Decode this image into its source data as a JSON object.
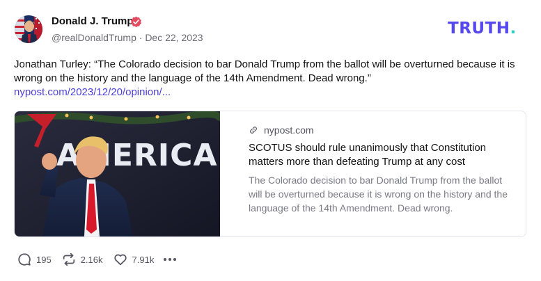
{
  "author": {
    "display_name": "Donald J. Trump",
    "handle": "@realDonaldTrump",
    "date": "Dec 22, 2023",
    "verified": true
  },
  "brand": {
    "name": "TRUTH",
    "dot": "."
  },
  "post": {
    "text": "Jonathan Turley: “The Colorado decision to bar Donald Trump from the ballot will be overturned because it is wrong on the history and the language of the 14th Amendment. Dead wrong.”",
    "link_text": "nypost.com/2023/12/20/opinion/..."
  },
  "card": {
    "domain": "nypost.com",
    "title": "SCOTUS should rule unanimously that Constitution matters more than defeating Trump at any cost",
    "description": "The Colorado decision to bar Donald Trump from the ballot will be overturned because it is wrong on the history and the language of the 14th Amendment. Dead wrong.",
    "image_sign_text": "AMERICA GAIN!"
  },
  "actions": {
    "replies": "195",
    "retruths": "2.16k",
    "likes": "7.91k"
  },
  "icons": {
    "avatar": "avatar-flag-portrait",
    "verified": "verified-badge-icon",
    "link": "link-icon",
    "reply": "reply-bubble-icon",
    "retruth": "retruth-arrows-icon",
    "like": "heart-icon",
    "more": "more-dots-icon"
  },
  "colors": {
    "brand": "#5448ee",
    "brand_dot": "#2bd0c6",
    "link": "#4a3fd8",
    "verified": "#e24b5f",
    "muted": "#6b6b76"
  }
}
